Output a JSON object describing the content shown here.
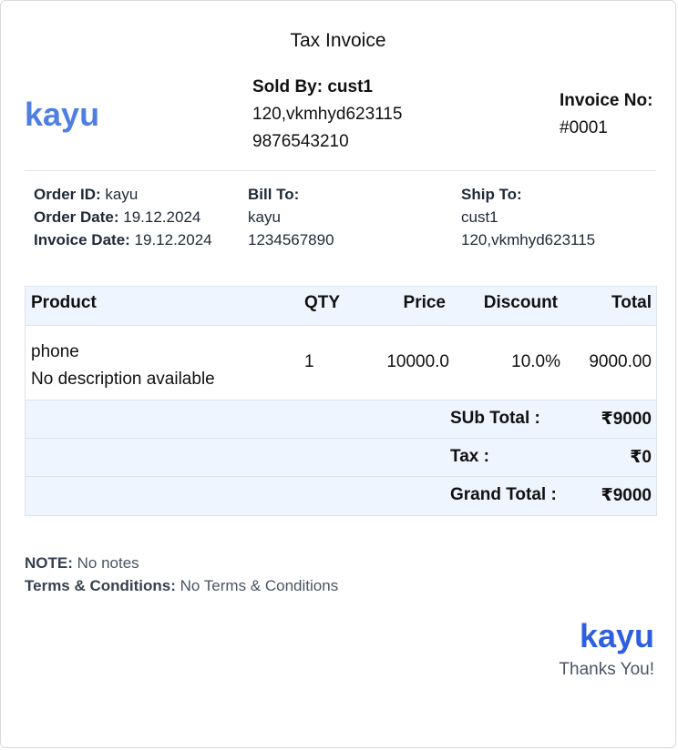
{
  "invoice_title": "Tax Invoice",
  "brand": "kayu",
  "seller": {
    "label": "Sold By:",
    "name": "cust1",
    "address": "120,vkmhyd623115",
    "phone": "9876543210"
  },
  "invoice_no": {
    "label": "Invoice No:",
    "value": "#0001"
  },
  "order": {
    "id_label": "Order ID:",
    "id": "kayu",
    "date_label": "Order Date:",
    "date": "19.12.2024",
    "invoice_date_label": "Invoice Date:",
    "invoice_date": "19.12.2024"
  },
  "bill_to": {
    "label": "Bill To:",
    "name": "kayu",
    "phone": "1234567890"
  },
  "ship_to": {
    "label": "Ship To:",
    "name": "cust1",
    "address": "120,vkmhyd623115"
  },
  "table": {
    "headers": {
      "product": "Product",
      "qty": "QTY",
      "price": "Price",
      "discount": "Discount",
      "total": "Total"
    },
    "items": [
      {
        "name": "phone",
        "description": "No description available",
        "qty": "1",
        "price": "10000.0",
        "discount": "10.0%",
        "total": "9000.00"
      }
    ],
    "subtotal_label": "SUb Total :",
    "subtotal": "₹9000",
    "tax_label": "Tax :",
    "tax": "₹0",
    "grand_total_label": "Grand Total :",
    "grand_total": "₹9000"
  },
  "notes": {
    "note_label": "NOTE:",
    "note": "No notes",
    "terms_label": "Terms & Conditions:",
    "terms": "No Terms & Conditions"
  },
  "footer": {
    "brand": "kayu",
    "thanks": "Thanks You!"
  },
  "colors": {
    "brand": "#4f7fe0",
    "footer_brand": "#2f5fe0",
    "table_header_bg": "#eff5ff"
  }
}
